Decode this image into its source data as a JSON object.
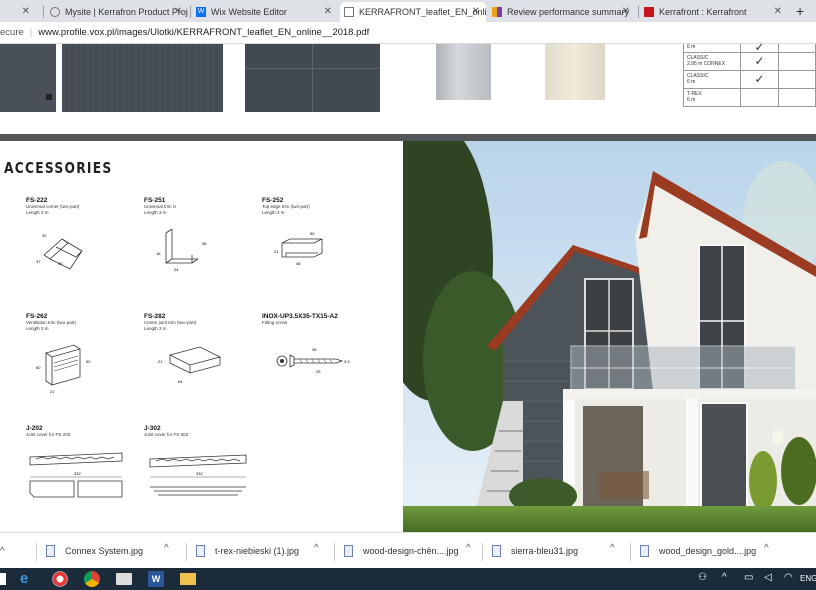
{
  "tabs": [
    {
      "title": "Mysite | Kerrafron Product Proj",
      "favicon_color": "#777777"
    },
    {
      "title": "Wix Website Editor",
      "favicon_color": "#0c6efc"
    },
    {
      "title": "KERRAFRONT_leaflet_EN_onlin",
      "favicon_color": "#777777"
    },
    {
      "title": "Review performance summary",
      "favicon_color": "#e8a317"
    },
    {
      "title": "Kerrafront : Kerrafront",
      "favicon_color": "#c4161c"
    }
  ],
  "address": {
    "secure_label": "ecure",
    "url": "www.profile.vox.pl/images/Ulotki/KERRAFRONT_leaflet_EN_online__2018.pdf"
  },
  "table": {
    "rows": [
      {
        "name": "",
        "length": "6 m",
        "check": "✓"
      },
      {
        "name": "CLASSIC",
        "length": "2,95 m CONNEX",
        "check": "✓"
      },
      {
        "name": "CLASSIC",
        "length": "6 m",
        "check": "✓"
      },
      {
        "name": "T-REX",
        "length": "6 m",
        "check": ""
      }
    ]
  },
  "accessories": {
    "title": "ACCESSORIES",
    "items": [
      {
        "code": "FS-222",
        "desc1": "Universal corner (two-part)",
        "desc2": "Length 3 m"
      },
      {
        "code": "FS-251",
        "desc1": "Universal trim U",
        "desc2": "Length 3 m"
      },
      {
        "code": "FS-252",
        "desc1": "Top edge trim (two-part)",
        "desc2": "Length 3 m"
      },
      {
        "code": "FS-262",
        "desc1": "Ventilation trim (two-part)",
        "desc2": "Length 3 m"
      },
      {
        "code": "FS-282",
        "desc1": "Center joint trim (two-part)",
        "desc2": "Length 3 m"
      },
      {
        "code": "INOX-UP3.5X35-TX15-A2",
        "desc1": "Fitting screw",
        "desc2": ""
      },
      {
        "code": "J-202",
        "desc1": "Joint cover for FS-202",
        "desc2": ""
      },
      {
        "code": "J-302",
        "desc1": "Joint cover for FS-302",
        "desc2": ""
      }
    ],
    "dims": {
      "fs222_a": "30",
      "fs222_b": "37",
      "fs222_c": "40",
      "fs251_a": "38",
      "fs251_b": "16",
      "fs251_c": "24",
      "fs252_a": "21",
      "fs252_b": "50",
      "fs252_c": "48",
      "fs262_a": "60",
      "fs262_b": "50",
      "fs262_c": "21",
      "fs282_a": "21",
      "fs282_b": "64",
      "inox_a": "35",
      "inox_b": "25",
      "inox_c": "3.5",
      "j202": "332",
      "j302": "332"
    }
  },
  "downloads": [
    {
      "name": "Connex System.jpg"
    },
    {
      "name": "t-rex-niebieski (1).jpg"
    },
    {
      "name": "wood-design-chên....jpg"
    },
    {
      "name": "sierra-bleu31.jpg"
    },
    {
      "name": "wood_design_gold....jpg"
    }
  ],
  "tray": {
    "lang": "ENG"
  }
}
